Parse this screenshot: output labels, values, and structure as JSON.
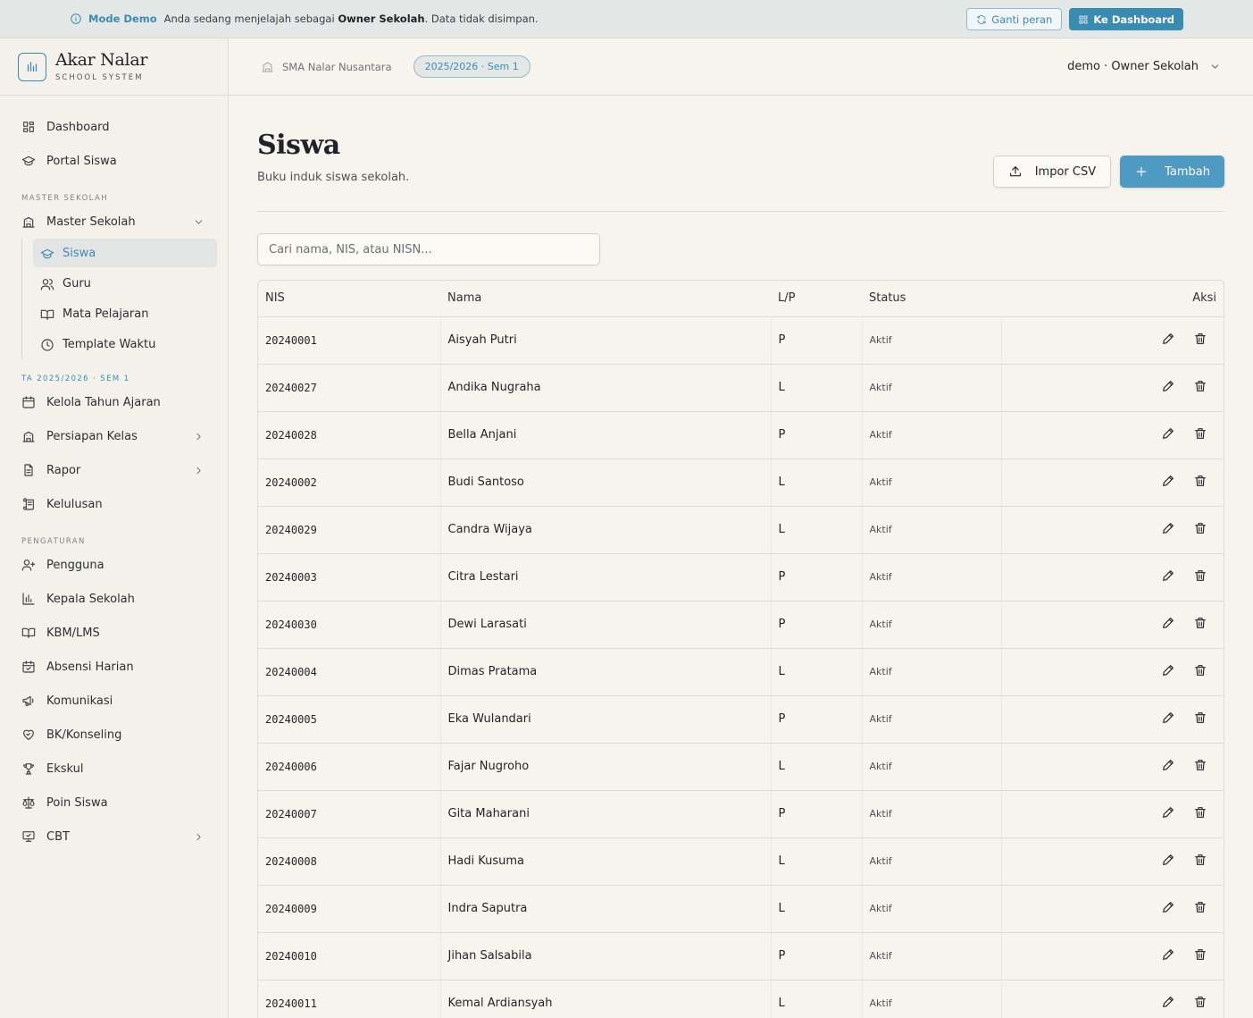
{
  "banner": {
    "mode": "Mode Demo",
    "text_pre": "Anda sedang menjelajah sebagai ",
    "role": "Owner Sekolah",
    "text_post": ". Data tidak disimpan.",
    "switch_role": "Ganti peran",
    "to_dashboard": "Ke Dashboard"
  },
  "brand": {
    "name": "Akar Nalar",
    "subtitle": "SCHOOL SYSTEM"
  },
  "sidebar": {
    "top_items": [
      {
        "label": "Dashboard",
        "icon": "dashboard-icon"
      },
      {
        "label": "Portal Siswa",
        "icon": "graduation-cap-icon"
      }
    ],
    "section_master": "MASTER SEKOLAH",
    "master_group": {
      "label": "Master Sekolah",
      "icon": "school-building-icon"
    },
    "master_sub": [
      {
        "label": "Siswa",
        "icon": "graduation-cap-icon",
        "active": true
      },
      {
        "label": "Guru",
        "icon": "users-icon"
      },
      {
        "label": "Mata Pelajaran",
        "icon": "book-open-icon"
      },
      {
        "label": "Template Waktu",
        "icon": "clock-icon"
      }
    ],
    "section_ta": "TA 2025/2026 · SEM 1",
    "ta_items": [
      {
        "label": "Kelola Tahun Ajaran",
        "icon": "calendar-icon"
      },
      {
        "label": "Persiapan Kelas",
        "icon": "school-building-icon"
      },
      {
        "label": "Rapor",
        "icon": "document-icon"
      },
      {
        "label": "Kelulusan",
        "icon": "scroll-icon"
      }
    ],
    "section_settings": "PENGATURAN",
    "settings_items": [
      {
        "label": "Pengguna",
        "icon": "user-plus-icon"
      },
      {
        "label": "Kepala Sekolah",
        "icon": "bar-chart-icon"
      },
      {
        "label": "KBM/LMS",
        "icon": "book-open-icon"
      },
      {
        "label": "Absensi Harian",
        "icon": "calendar-check-icon"
      },
      {
        "label": "Komunikasi",
        "icon": "megaphone-icon"
      },
      {
        "label": "BK/Konseling",
        "icon": "heart-handshake-icon"
      },
      {
        "label": "Ekskul",
        "icon": "trophy-icon"
      },
      {
        "label": "Poin Siswa",
        "icon": "scale-icon"
      },
      {
        "label": "CBT",
        "icon": "monitor-check-icon"
      }
    ]
  },
  "topbar": {
    "school": "SMA Nalar Nusantara",
    "term": "2025/2026 · Sem 1",
    "user": "demo · Owner Sekolah"
  },
  "page": {
    "title": "Siswa",
    "subtitle": "Buku induk siswa sekolah.",
    "import_label": "Impor CSV",
    "add_label": "Tambah",
    "search_placeholder": "Cari nama, NIS, atau NISN..."
  },
  "table": {
    "headers": {
      "nis": "NIS",
      "nama": "Nama",
      "lp": "L/P",
      "status": "Status",
      "aksi": "Aksi"
    },
    "rows": [
      {
        "nis": "20240001",
        "nama": "Aisyah Putri",
        "lp": "P",
        "status": "Aktif"
      },
      {
        "nis": "20240027",
        "nama": "Andika Nugraha",
        "lp": "L",
        "status": "Aktif"
      },
      {
        "nis": "20240028",
        "nama": "Bella Anjani",
        "lp": "P",
        "status": "Aktif"
      },
      {
        "nis": "20240002",
        "nama": "Budi Santoso",
        "lp": "L",
        "status": "Aktif"
      },
      {
        "nis": "20240029",
        "nama": "Candra Wijaya",
        "lp": "L",
        "status": "Aktif"
      },
      {
        "nis": "20240003",
        "nama": "Citra Lestari",
        "lp": "P",
        "status": "Aktif"
      },
      {
        "nis": "20240030",
        "nama": "Dewi Larasati",
        "lp": "P",
        "status": "Aktif"
      },
      {
        "nis": "20240004",
        "nama": "Dimas Pratama",
        "lp": "L",
        "status": "Aktif"
      },
      {
        "nis": "20240005",
        "nama": "Eka Wulandari",
        "lp": "P",
        "status": "Aktif"
      },
      {
        "nis": "20240006",
        "nama": "Fajar Nugroho",
        "lp": "L",
        "status": "Aktif"
      },
      {
        "nis": "20240007",
        "nama": "Gita Maharani",
        "lp": "P",
        "status": "Aktif"
      },
      {
        "nis": "20240008",
        "nama": "Hadi Kusuma",
        "lp": "L",
        "status": "Aktif"
      },
      {
        "nis": "20240009",
        "nama": "Indra Saputra",
        "lp": "L",
        "status": "Aktif"
      },
      {
        "nis": "20240010",
        "nama": "Jihan Salsabila",
        "lp": "P",
        "status": "Aktif"
      },
      {
        "nis": "20240011",
        "nama": "Kemal Ardiansyah",
        "lp": "L",
        "status": "Aktif"
      }
    ]
  },
  "colors": {
    "accent": "#3c8bb5",
    "primary_button": "#4f9ac3",
    "background": "#f7f4ee",
    "sidebar": "#f4f1ea",
    "banner": "#e3e7e6"
  }
}
